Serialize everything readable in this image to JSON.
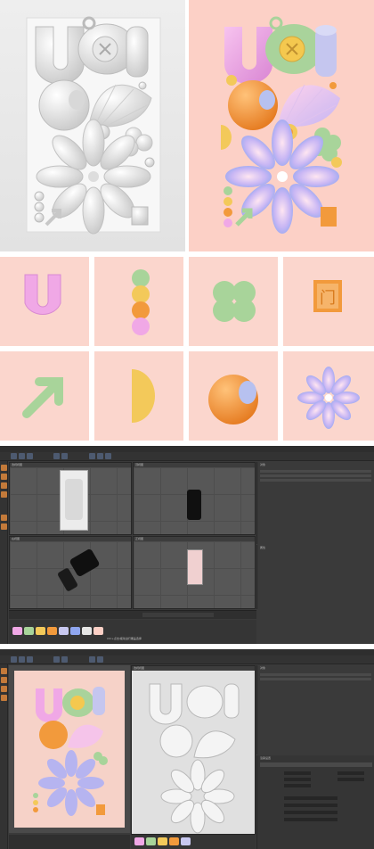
{
  "app": {
    "window_label": "编辑",
    "viewport_labels": [
      "透视视图",
      "顶视图",
      "右视图",
      "正视图"
    ],
    "panel_tabs": [
      "对象",
      "场次",
      "内容浏览器"
    ],
    "attr_tabs": [
      "属性",
      "层"
    ],
    "status": "Ctrl+点击/拖动进行覆盖选择",
    "render_settings_label": "渲染设置",
    "accent_orange": "#c37a3a",
    "accent_blue": "#4d5a70"
  },
  "artwork": {
    "sign_glyph": "门",
    "colors": {
      "pink_bg": "#fcd0c6",
      "lilac_u": "#f0a8e6",
      "green_cup": "#a8d49a",
      "yellow": "#f3c95a",
      "orange": "#f29a3c",
      "lavender": "#c8c8f0",
      "blue": "#8fa6f0"
    }
  }
}
